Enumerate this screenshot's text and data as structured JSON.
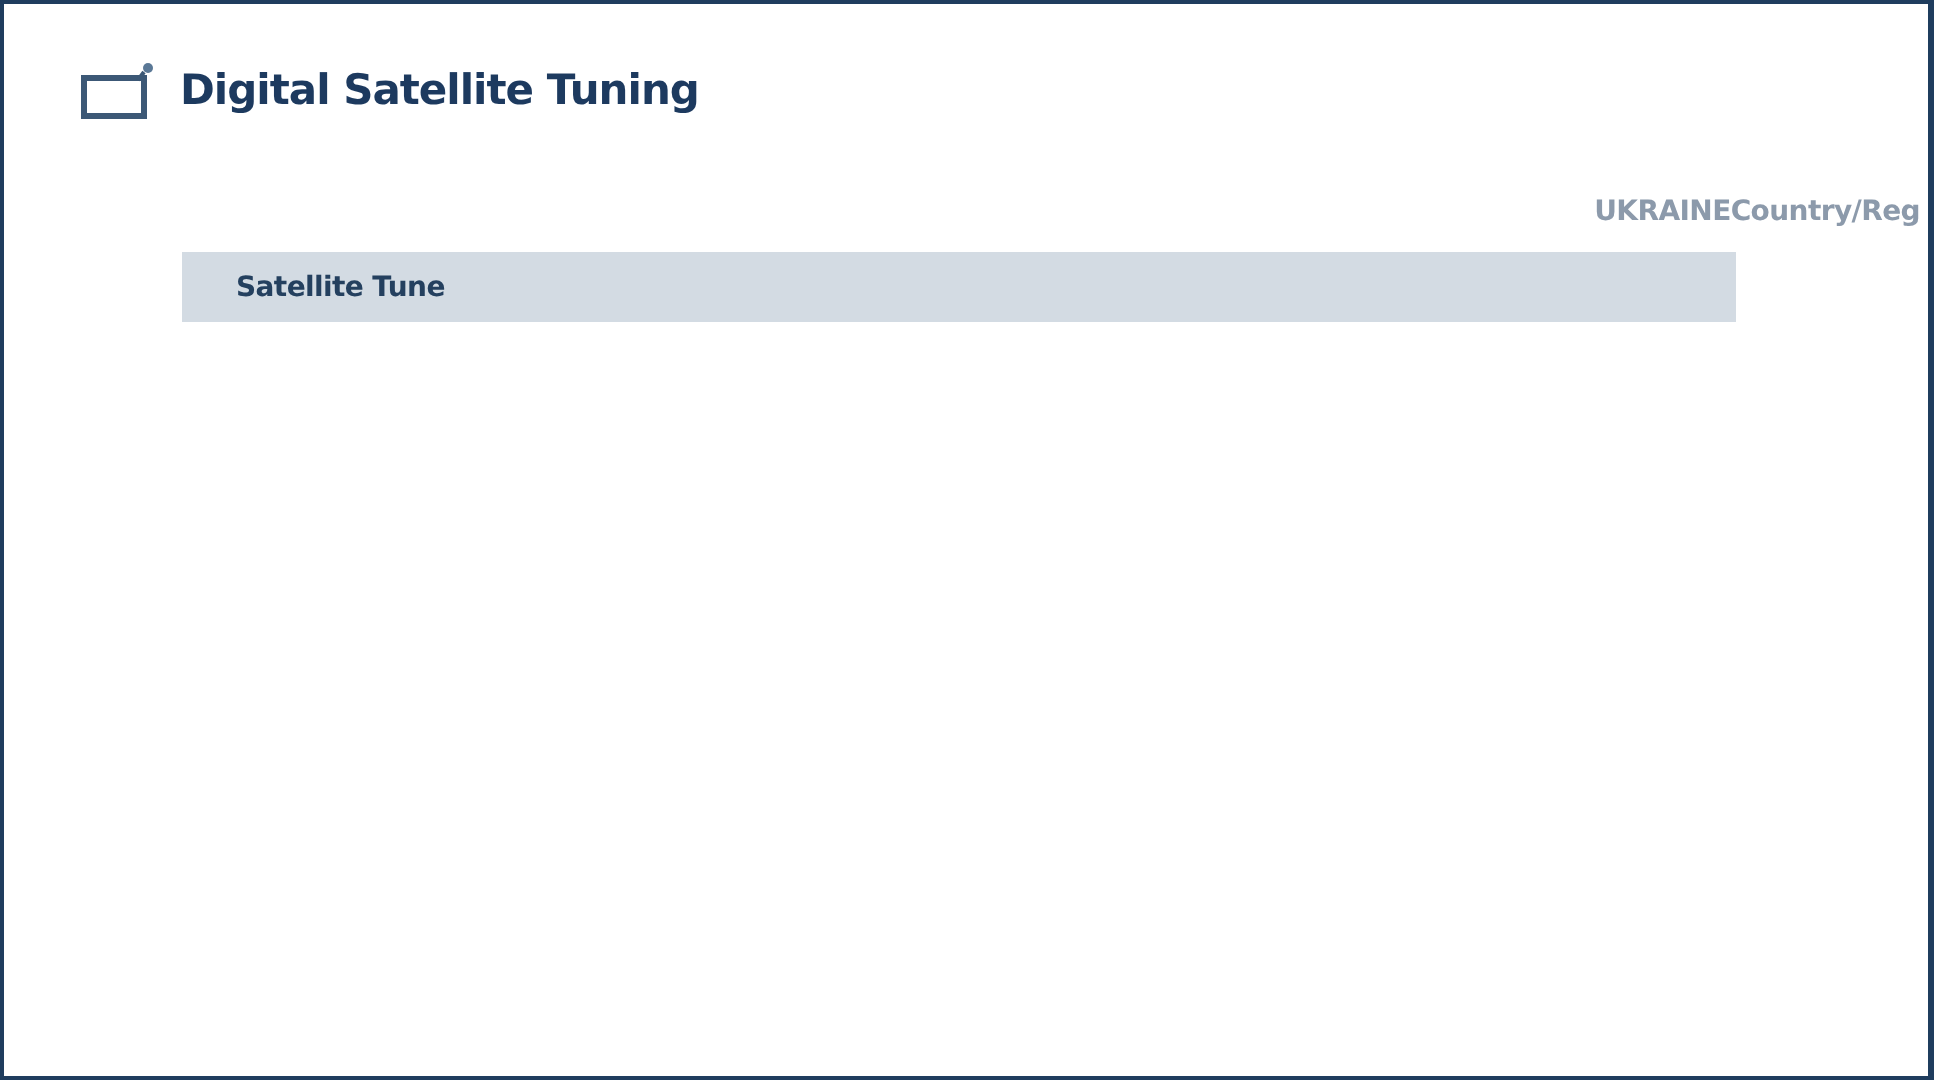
{
  "header": {
    "title": "Digital Satellite Tuning"
  },
  "country_region": "UKRAINECountry/Reg",
  "menu": [
    {
      "label": "Satellite Tune",
      "selected": true
    }
  ]
}
